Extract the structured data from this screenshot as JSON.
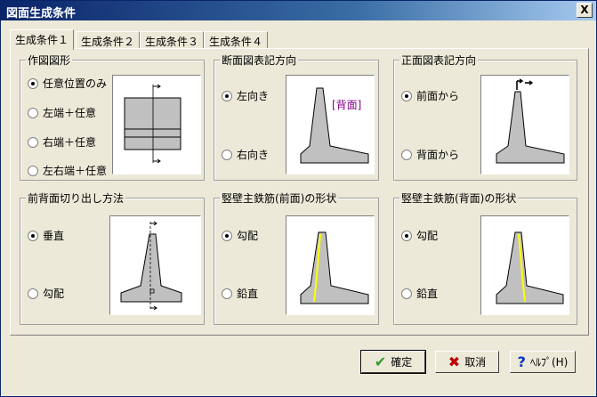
{
  "window": {
    "title": "図面生成条件",
    "close_label": "X"
  },
  "tabs": [
    "生成条件１",
    "生成条件２",
    "生成条件３",
    "生成条件４"
  ],
  "groups": {
    "drawing_shape": {
      "title": "作図図形",
      "options": [
        "任意位置のみ",
        "左端＋任意",
        "右端＋任意",
        "左右端＋任意"
      ],
      "selected_index": 0
    },
    "section_direction": {
      "title": "断面図表記方向",
      "options": [
        "左向き",
        "右向き"
      ],
      "selected_index": 0,
      "pic_label": "[背面]"
    },
    "front_direction": {
      "title": "正面図表記方向",
      "options": [
        "前面から",
        "背面から"
      ],
      "selected_index": 0
    },
    "cut_method": {
      "title": "前背面切り出し方法",
      "options": [
        "垂直",
        "勾配"
      ],
      "selected_index": 0
    },
    "rebar_front": {
      "title": "竪壁主鉄筋(前面)の形状",
      "options": [
        "勾配",
        "鉛直"
      ],
      "selected_index": 0
    },
    "rebar_back": {
      "title": "竪壁主鉄筋(背面)の形状",
      "options": [
        "勾配",
        "鉛直"
      ],
      "selected_index": 0
    }
  },
  "buttons": {
    "ok": "確定",
    "cancel": "取消",
    "help": "ﾍﾙﾌﾟ(H)"
  },
  "colors": {
    "accent_check": "#2e9b2e",
    "cancel_x": "#c00000",
    "help_q": "#0033cc",
    "rebar": "#ffff00",
    "label_purple": "#800080",
    "shape_fill": "#c0c0c0"
  }
}
